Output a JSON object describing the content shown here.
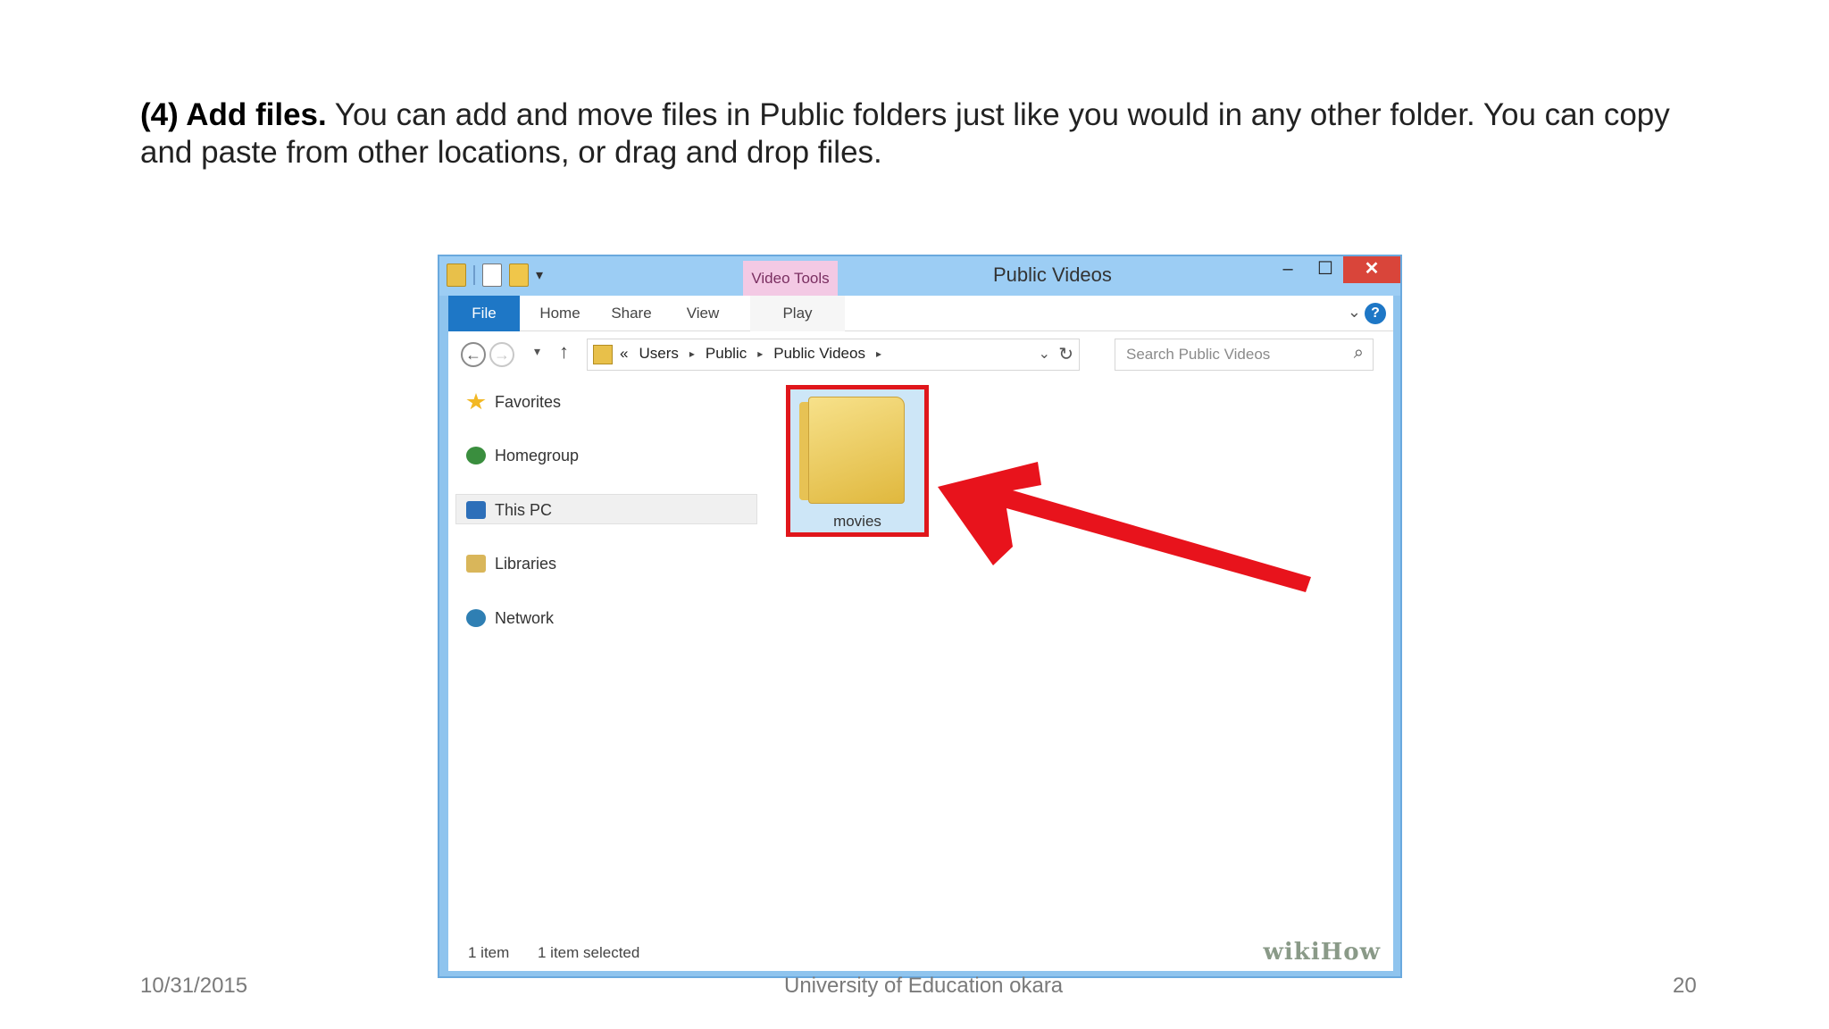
{
  "slide": {
    "heading_bold": "(4) Add files.",
    "body": " You can add and move files in Public folders just like you would in any other folder. You can copy and paste from other locations, or drag and drop files.",
    "footer_date": "10/31/2015",
    "footer_center": "University of Education okara",
    "footer_page": "20"
  },
  "window": {
    "title": "Public Videos",
    "context_tab": "Video Tools",
    "controls": {
      "minimize": "–",
      "maximize": "☐",
      "close": "✕"
    },
    "ribbon_tabs": {
      "file": "File",
      "home": "Home",
      "share": "Share",
      "view": "View",
      "play": "Play"
    },
    "help": "?",
    "address": {
      "prefix": "«",
      "crumbs": [
        "Users",
        "Public",
        "Public Videos"
      ],
      "separator": "▸"
    },
    "search_placeholder": "Search Public Videos",
    "nav_items": {
      "favorites": "Favorites",
      "homegroup": "Homegroup",
      "thispc": "This PC",
      "libraries": "Libraries",
      "network": "Network"
    },
    "folder": {
      "name": "movies"
    },
    "status": {
      "count": "1 item",
      "selected": "1 item selected"
    },
    "watermark": "wikiHow"
  },
  "colors": {
    "highlight": "#e0161b",
    "accent": "#1e77c6",
    "window_frame": "#8fc4ee"
  }
}
